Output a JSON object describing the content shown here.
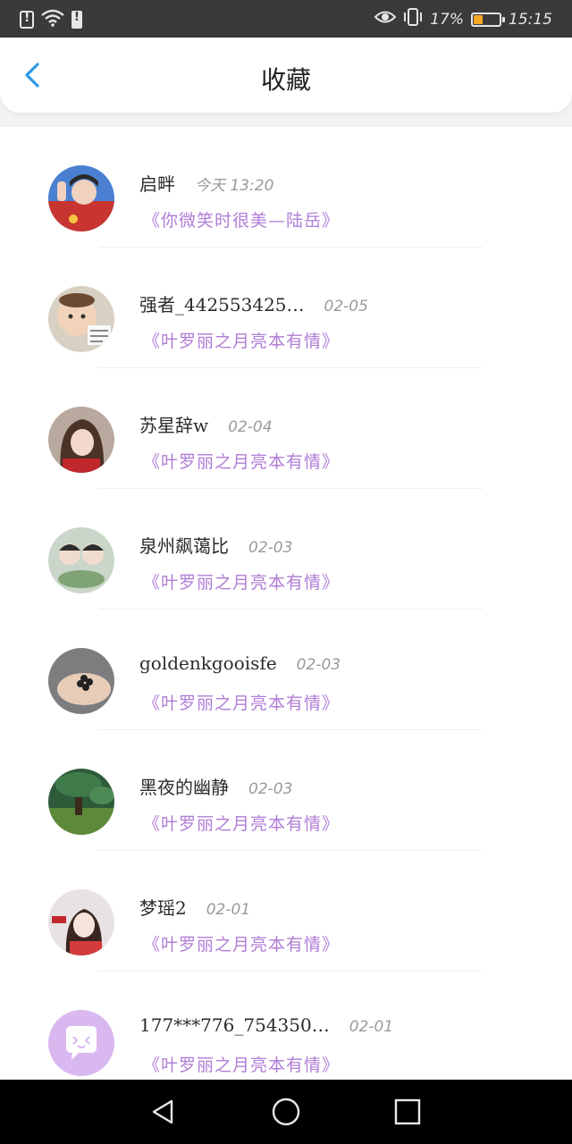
{
  "status_bar": {
    "battery_percent": "17%",
    "battery_level": 0.17,
    "time": "15:15",
    "icons": [
      "alert-icon",
      "wifi-icon",
      "sim-alert-icon",
      "eye-icon",
      "vibrate-icon",
      "battery-icon"
    ]
  },
  "header": {
    "title": "收藏",
    "back_icon": "chevron-left-icon",
    "accent_color": "#2e9ae6"
  },
  "items": [
    {
      "name": "启畔",
      "time": "今天 13:20",
      "title": "《你微笑时很美—陆岳》"
    },
    {
      "name": "强者_442553425…",
      "time": "02-05",
      "title": "《叶罗丽之月亮本有情》"
    },
    {
      "name": "苏星辞w",
      "time": "02-04",
      "title": "《叶罗丽之月亮本有情》"
    },
    {
      "name": "泉州飙蔼比",
      "time": "02-03",
      "title": "《叶罗丽之月亮本有情》"
    },
    {
      "name": "goldenkgooisfe",
      "time": "02-03",
      "title": "《叶罗丽之月亮本有情》"
    },
    {
      "name": "黑夜的幽静",
      "time": "02-03",
      "title": "《叶罗丽之月亮本有情》"
    },
    {
      "name": "梦瑶2",
      "time": "02-01",
      "title": "《叶罗丽之月亮本有情》"
    },
    {
      "name": "177***776_754350…",
      "time": "02-01",
      "title": "《叶罗丽之月亮本有情》"
    }
  ],
  "colors": {
    "title_purple": "#b07dd6",
    "default_avatar": "#d9b8f0"
  },
  "nav": {
    "icons": [
      "back-triangle-icon",
      "home-circle-icon",
      "recents-square-icon"
    ]
  }
}
